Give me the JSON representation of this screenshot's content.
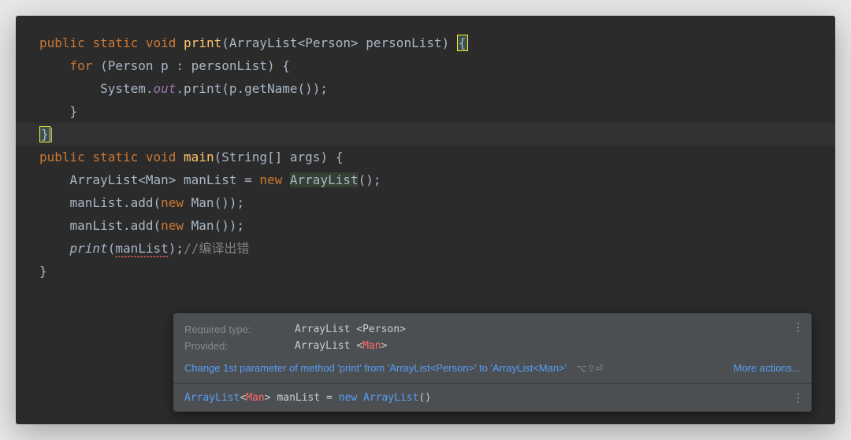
{
  "code": {
    "l1_public": "public",
    "l1_static": "static",
    "l1_void": "void",
    "l1_method": "print",
    "l1_params_open": "(",
    "l1_type1": "ArrayList",
    "l1_generic_open": "<",
    "l1_type2": "Person",
    "l1_generic_close": ">",
    "l1_param_name": " personList",
    "l1_params_close": ")",
    "l1_brace": "{",
    "l2_indent": "    ",
    "l2_for": "for",
    "l2_rest": " (Person p : personList) {",
    "l3_indent": "        ",
    "l3_sys": "System.",
    "l3_out": "out",
    "l3_rest": ".print(p.getName());",
    "l4": "    }",
    "l5": "}",
    "blank": "",
    "l7_public": "public",
    "l7_static": "static",
    "l7_void": "void",
    "l7_method": "main",
    "l7_rest": "(String[] args) {",
    "l8_indent": "    ",
    "l8_a": "ArrayList<Man> manList = ",
    "l8_new": "new",
    "l8_space": " ",
    "l8_ctor": "ArrayList",
    "l8_b": "();",
    "l9_indent": "    ",
    "l9_a": "manList.add(",
    "l9_new": "new",
    "l9_b": " Man());",
    "l10_indent": "    ",
    "l10_a": "manList.add(",
    "l10_new": "new",
    "l10_b": " Man());",
    "l11_indent": "    ",
    "l11_call": "print",
    "l11_open": "(",
    "l11_arg": "manList",
    "l11_close": ")",
    "l11_semi": ";",
    "l11_comment": "//编译出错",
    "l12": "}"
  },
  "tooltip": {
    "required_label": "Required type:",
    "required_value_a": "ArrayList ",
    "required_value_b": "<Person>",
    "provided_label": "Provided:",
    "provided_value_a": "ArrayList ",
    "provided_value_open": "<",
    "provided_value_red": "Man",
    "provided_value_close": ">",
    "quickfix": "Change 1st parameter of method 'print' from 'ArrayList<Person>' to 'ArrayList<Man>'",
    "shortcut": "⌥⇧⏎",
    "more": "More actions...",
    "context_a": "ArrayList",
    "context_open": "<",
    "context_red": "Man",
    "context_close": ">",
    "context_mid": " manList = ",
    "context_new": "new",
    "context_b": " ",
    "context_ctor": "ArrayList",
    "context_end": "()"
  }
}
